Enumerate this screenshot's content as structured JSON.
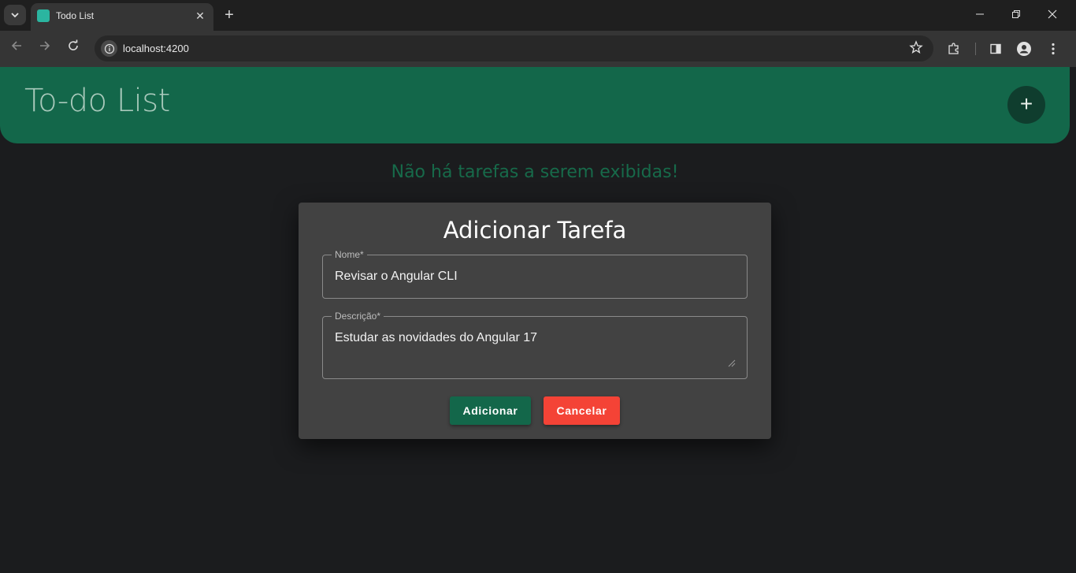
{
  "browser": {
    "tab_title": "Todo List",
    "url": "localhost:4200",
    "new_tab": "+",
    "tab_close": "✕"
  },
  "app": {
    "title": "To-do List",
    "add_symbol": "+",
    "empty_message": "Não há tarefas a serem exibidas!"
  },
  "dialog": {
    "title": "Adicionar Tarefa",
    "name_label": "Nome*",
    "name_value": "Revisar o Angular CLI",
    "description_label": "Descrição*",
    "description_value": "Estudar as novidades do Angular 17",
    "add_button": "Adicionar",
    "cancel_button": "Cancelar"
  },
  "colors": {
    "header": "#13674a",
    "fab": "#0f3d2e",
    "add_button": "#13674a",
    "cancel_button": "#f44336",
    "dialog": "#424242",
    "background": "#1b1c1e"
  }
}
